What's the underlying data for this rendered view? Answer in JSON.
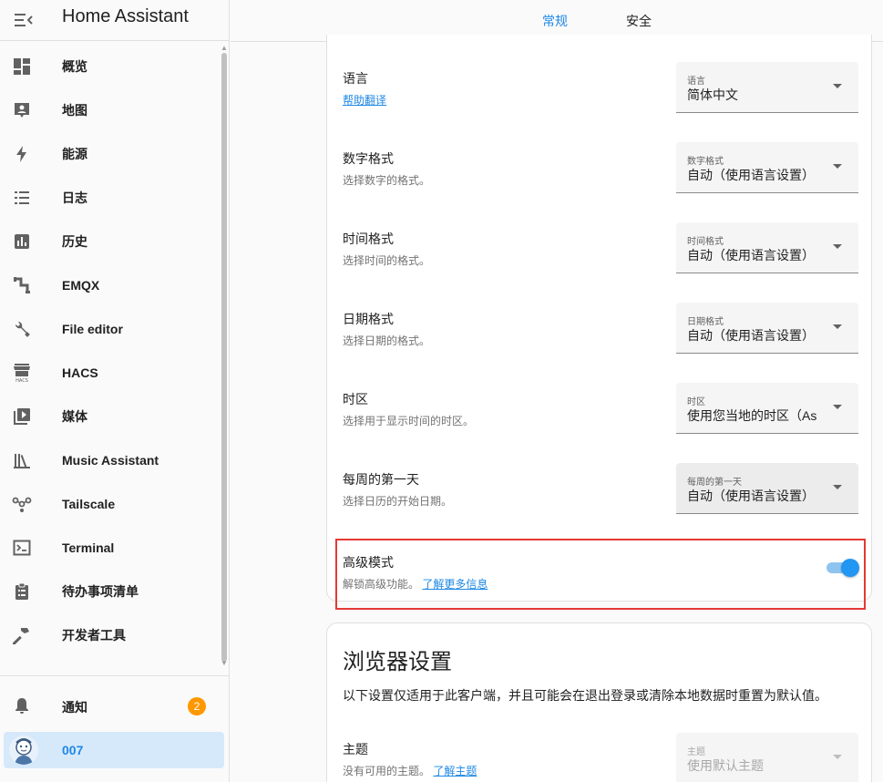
{
  "sidebar": {
    "title": "Home Assistant",
    "items": [
      {
        "label": "概览",
        "icon": "dashboard-icon"
      },
      {
        "label": "地图",
        "icon": "map-account-icon"
      },
      {
        "label": "能源",
        "icon": "lightning-icon"
      },
      {
        "label": "日志",
        "icon": "list-icon"
      },
      {
        "label": "历史",
        "icon": "chart-box-icon"
      },
      {
        "label": "EMQX",
        "icon": "pipe-icon"
      },
      {
        "label": "File editor",
        "icon": "wrench-icon"
      },
      {
        "label": "HACS",
        "icon": "hacs-icon"
      },
      {
        "label": "媒体",
        "icon": "play-box-icon"
      },
      {
        "label": "Music Assistant",
        "icon": "library-icon"
      },
      {
        "label": "Tailscale",
        "icon": "tailscale-icon"
      },
      {
        "label": "Terminal",
        "icon": "console-icon"
      },
      {
        "label": "待办事项清单",
        "icon": "clipboard-list-icon"
      },
      {
        "label": "开发者工具",
        "icon": "hammer-icon"
      }
    ],
    "notifications": {
      "label": "通知",
      "count": "2"
    },
    "user": {
      "label": "007"
    }
  },
  "tabs": {
    "general": "常规",
    "security": "安全"
  },
  "settings": {
    "language": {
      "title": "语言",
      "link": "帮助翻译",
      "field_label": "语言",
      "value": "简体中文"
    },
    "number_format": {
      "title": "数字格式",
      "subtitle": "选择数字的格式。",
      "field_label": "数字格式",
      "value": "自动（使用语言设置）"
    },
    "time_format": {
      "title": "时间格式",
      "subtitle": "选择时间的格式。",
      "field_label": "时间格式",
      "value": "自动（使用语言设置）"
    },
    "date_format": {
      "title": "日期格式",
      "subtitle": "选择日期的格式。",
      "field_label": "日期格式",
      "value": "自动（使用语言设置）"
    },
    "timezone": {
      "title": "时区",
      "subtitle": "选择用于显示时间的时区。",
      "field_label": "时区",
      "value": "使用您当地的时区（As"
    },
    "first_weekday": {
      "title": "每周的第一天",
      "subtitle": "选择日历的开始日期。",
      "field_label": "每周的第一天",
      "value": "自动（使用语言设置）"
    },
    "advanced": {
      "title": "高级模式",
      "subtitle": "解锁高级功能。",
      "link": "了解更多信息",
      "enabled": true
    }
  },
  "browser": {
    "heading": "浏览器设置",
    "description": "以下设置仅适用于此客户端，并且可能会在退出登录或清除本地数据时重置为默认值。",
    "theme": {
      "title": "主题",
      "subtitle": "没有可用的主题。",
      "link": "了解主题",
      "field_label": "主题",
      "value": "使用默认主题"
    }
  },
  "colors": {
    "accent": "#1e88e5",
    "badge": "#ff9800",
    "highlight": "#e53935"
  }
}
